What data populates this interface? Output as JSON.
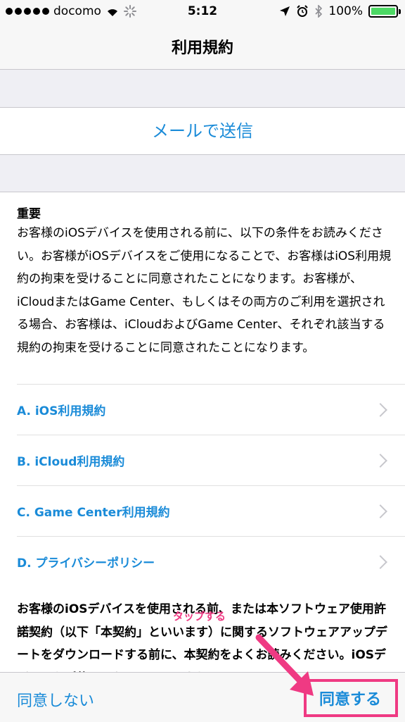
{
  "status_bar": {
    "carrier": "docomo",
    "time": "5:12",
    "battery": "100%",
    "icons": [
      "signal-dots-icon",
      "wifi-icon",
      "loading-spinner-icon",
      "location-arrow-icon",
      "alarm-icon",
      "bluetooth-icon",
      "battery-icon"
    ]
  },
  "nav": {
    "title": "利用規約"
  },
  "mail_send": {
    "label": "メールで送信"
  },
  "content": {
    "heading": "重要",
    "intro": "お客様のiOSデバイスを使用される前に、以下の条件をお読みください。お客様がiOSデバイスをご使用になることで、お客様はiOS利用規約の拘束を受けることに同意されたことになります。お客様が、iCloudまたはGame Center、もしくはその両方のご利用を選択される場合、お客様は、iCloudおよびGame Center、それぞれ該当する規約の拘束を受けることに同意されたことになります。",
    "links": [
      {
        "label": "A. iOS利用規約"
      },
      {
        "label": "B. iCloud利用規約"
      },
      {
        "label": "C. Game Center利用規約"
      },
      {
        "label": "D. プライバシーポリシー"
      }
    ],
    "body2": "お客様のiOSデバイスを使用される前、または本ソフトウェア使用許諾契約（以下「本契約」といいます）に関するソフトウェアアップデートをダウンロードする前に、本契約をよくお読みください。iOSデバイスをご使用になることで、またはソフト"
  },
  "toolbar": {
    "disagree_label": "同意しない",
    "agree_label": "同意する"
  },
  "annotation": {
    "tap_note": "タップする",
    "color": "#ef3a83"
  },
  "colors": {
    "link_blue": "#1a8bd8",
    "battery_green": "#4cd964"
  }
}
